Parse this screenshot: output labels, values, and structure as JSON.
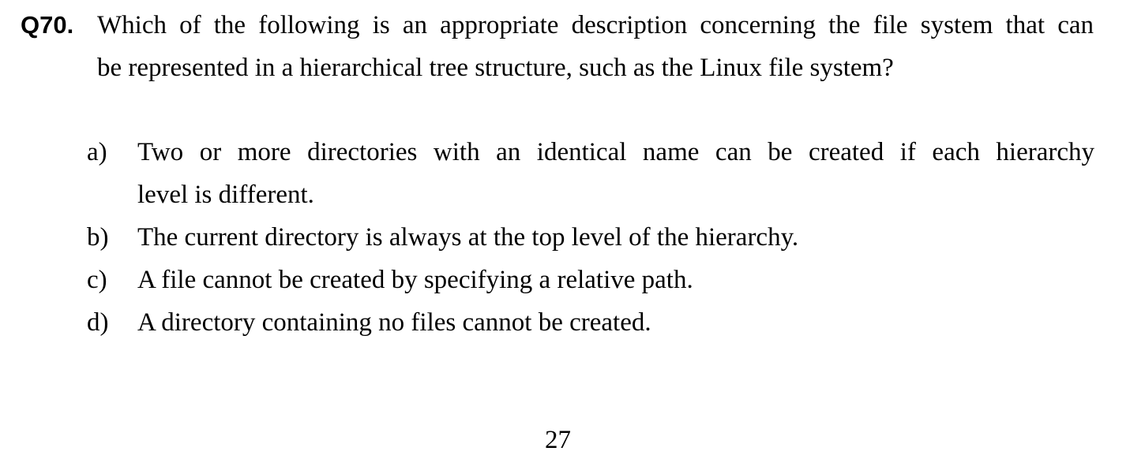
{
  "question": {
    "number": "Q70.",
    "lines": [
      "Which of the following is an appropriate description concerning the file system that can",
      "be represented in a hierarchical tree structure, such as the Linux file system?"
    ]
  },
  "options": [
    {
      "label": "a)",
      "lines": [
        "Two or more directories with an identical name can be created if each hierarchy",
        "level is different."
      ]
    },
    {
      "label": "b)",
      "lines": [
        "The current directory is always at the top level of the hierarchy."
      ]
    },
    {
      "label": "c)",
      "lines": [
        "A file cannot be created by specifying a relative path."
      ]
    },
    {
      "label": "d)",
      "lines": [
        "A directory containing no files cannot be created."
      ]
    }
  ],
  "page_number": "27"
}
